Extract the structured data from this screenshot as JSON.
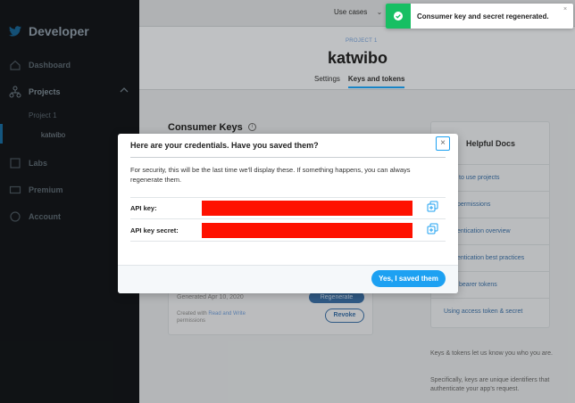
{
  "colors": {
    "accent": "#1da1f2",
    "sidebar_bg": "#14171a",
    "success": "#17bf63",
    "redaction": "#fe1100"
  },
  "sidebar": {
    "brand": "Developer",
    "items": [
      {
        "label": "Dashboard",
        "icon": "home-icon"
      },
      {
        "label": "Projects",
        "icon": "projects-icon"
      },
      {
        "label": "Labs",
        "icon": "labs-icon"
      },
      {
        "label": "Premium",
        "icon": "premium-icon"
      },
      {
        "label": "Account",
        "icon": "account-icon"
      }
    ],
    "project": "Project 1",
    "app": "katwibo"
  },
  "topbar": {
    "use_cases": "Use cases"
  },
  "project_header": {
    "label": "PROJECT 1",
    "title": "katwibo",
    "tabs": [
      "Settings",
      "Keys and tokens"
    ]
  },
  "consumer_keys": {
    "title": "Consumer Keys",
    "generated": "Generated Apr 10, 2020",
    "created_prefix": "Created with ",
    "created_perm": "Read and Write",
    "created_suffix": "permissions",
    "regenerate": "Regenerate",
    "revoke": "Revoke"
  },
  "helpful_docs": {
    "title": "Helpful Docs",
    "links": [
      "to use projects",
      "permissions",
      "entication overview",
      "entication best practices",
      "bearer tokens",
      "Using access token & secret"
    ],
    "text1": "Keys & tokens let us know you who you are.",
    "text2": "Specifically, keys are unique identifiers that authenticate your app's request."
  },
  "modal": {
    "title": "Here are your credentials. Have you saved them?",
    "description": "For security, this will be the last time we'll display these. If something happens, you can always regenerate them.",
    "api_key_label": "API key:",
    "api_secret_label": "API key secret:",
    "confirm_button": "Yes, I saved them",
    "close_glyph": "×"
  },
  "toast": {
    "message": "Consumer key and secret regenerated.",
    "close_glyph": "×"
  }
}
